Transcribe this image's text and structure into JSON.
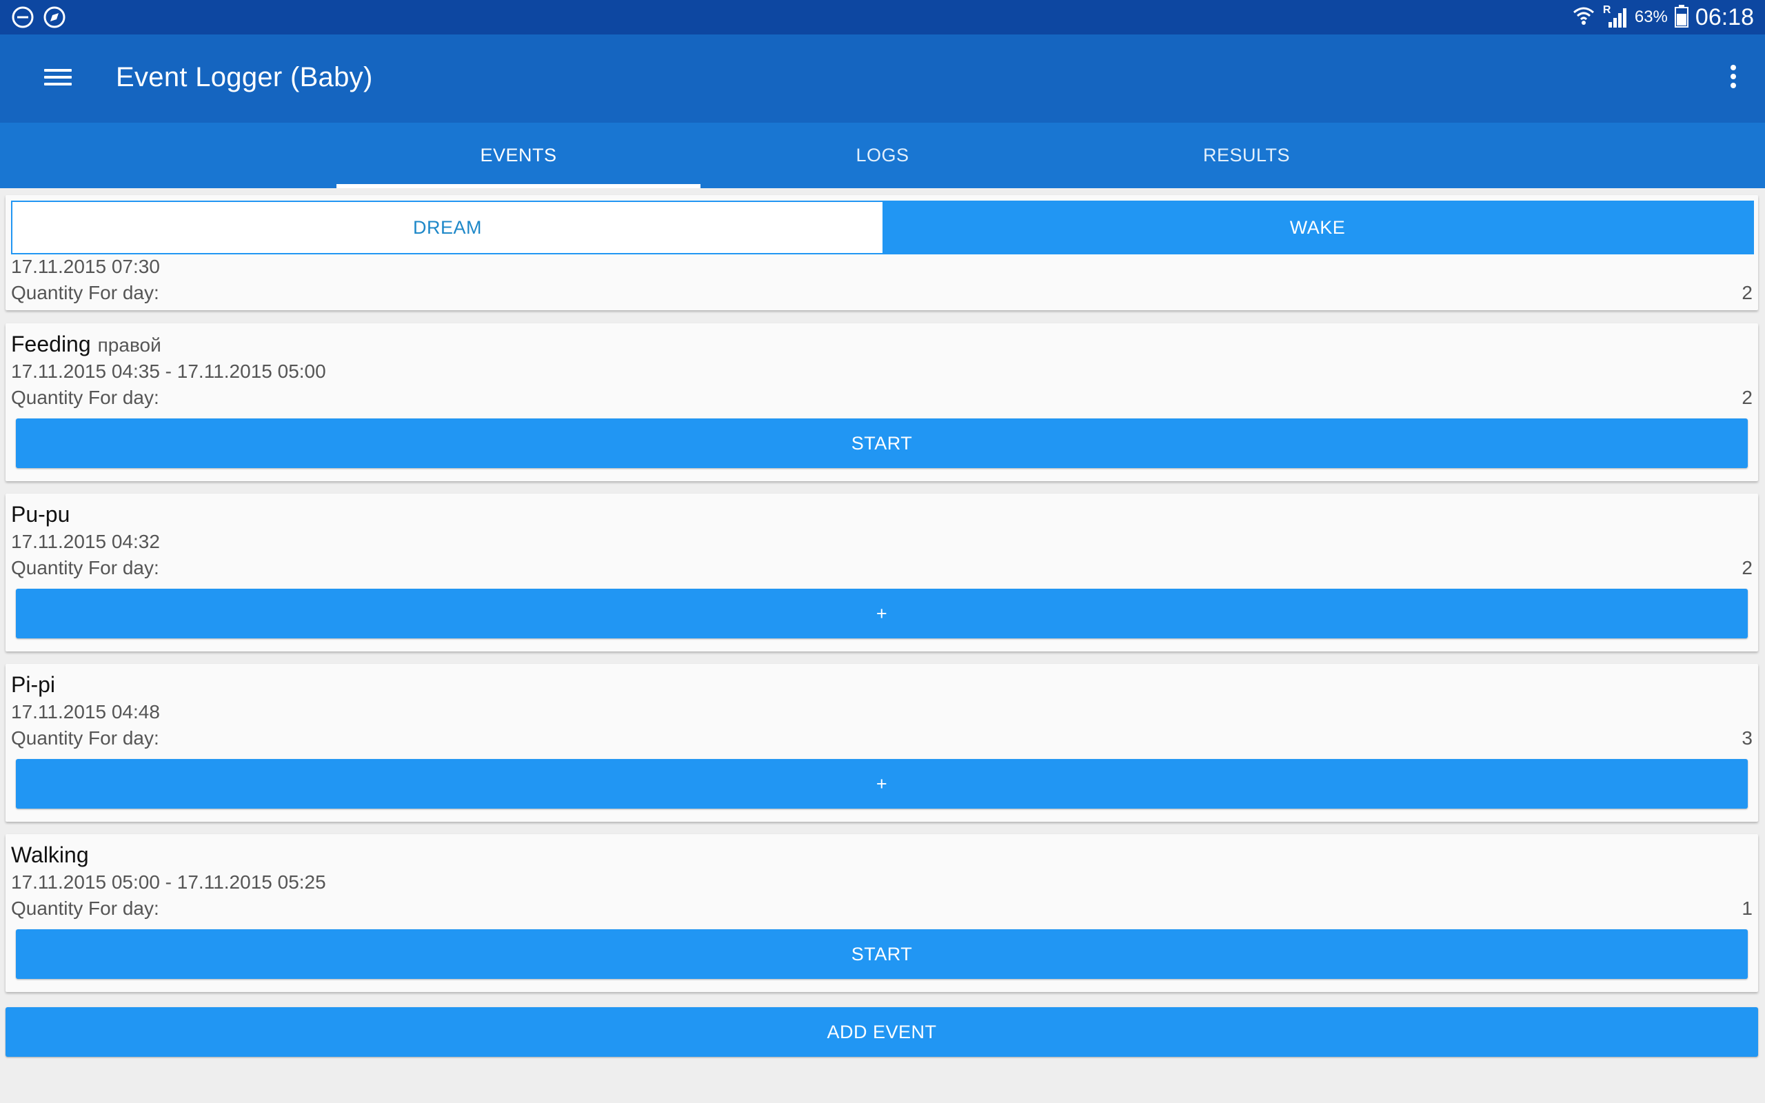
{
  "status_bar": {
    "left_icons": [
      "do-not-disturb-icon",
      "compass-icon"
    ],
    "right_icons": [
      "wifi-icon",
      "signal-icon",
      "battery-icon"
    ],
    "signal_roaming": "R",
    "battery_percent": "63%",
    "time": "06:18"
  },
  "app_bar": {
    "title": "Event Logger (Baby)",
    "menu_icon": "hamburger-menu-icon",
    "overflow_icon": "more-vert-icon"
  },
  "tabs": [
    {
      "label": "EVENTS",
      "active": true
    },
    {
      "label": "LOGS",
      "active": false
    },
    {
      "label": "RESULTS",
      "active": false
    }
  ],
  "events": [
    {
      "type": "toggle",
      "toggle_options": [
        "DREAM",
        "WAKE"
      ],
      "toggle_selected": "WAKE",
      "time": "17.11.2015 07:30",
      "quantity_label": "Quantity For day:",
      "quantity": "2"
    },
    {
      "type": "timer",
      "name": "Feeding",
      "subtitle": "правой",
      "time": "17.11.2015 04:35 - 17.11.2015 05:00",
      "quantity_label": "Quantity For day:",
      "quantity": "2",
      "button_label": "START"
    },
    {
      "type": "counter",
      "name": "Pu-pu",
      "subtitle": "",
      "time": "17.11.2015 04:32",
      "quantity_label": "Quantity For day:",
      "quantity": "2",
      "button_label": "+"
    },
    {
      "type": "counter",
      "name": "Pi-pi",
      "subtitle": "",
      "time": "17.11.2015 04:48",
      "quantity_label": "Quantity For day:",
      "quantity": "3",
      "button_label": "+"
    },
    {
      "type": "timer",
      "name": "Walking",
      "subtitle": "",
      "time": "17.11.2015 05:00 - 17.11.2015 05:25",
      "quantity_label": "Quantity For day:",
      "quantity": "1",
      "button_label": "START"
    }
  ],
  "add_event_label": "ADD EVENT",
  "colors": {
    "status_bar": "#0d47a1",
    "app_bar": "#1565c0",
    "tabs_bar": "#1976d2",
    "accent_button": "#2196f3",
    "background": "#eeeeee"
  }
}
